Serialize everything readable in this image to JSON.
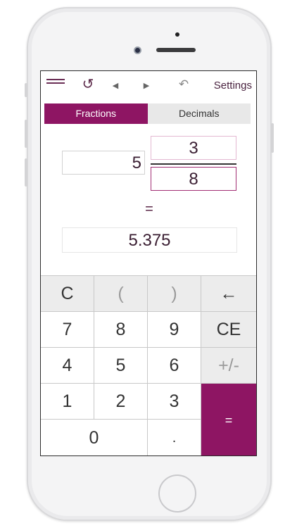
{
  "toolbar": {
    "menu_icon": "hamburger-menu-icon",
    "refresh_glyph": "↺",
    "prev_glyph": "◀",
    "next_glyph": "▶",
    "undo_glyph": "↶",
    "settings_label": "Settings"
  },
  "tabs": [
    {
      "label": "Fractions",
      "active": true
    },
    {
      "label": "Decimals",
      "active": false
    }
  ],
  "fraction": {
    "whole": "5",
    "numerator": "3",
    "denominator": "8"
  },
  "equals_label": "=",
  "result": "5.375",
  "keypad": {
    "clear": "C",
    "open_paren": "(",
    "close_paren": ")",
    "backspace": "←",
    "seven": "7",
    "eight": "8",
    "nine": "9",
    "clear_entry": "CE",
    "four": "4",
    "five": "5",
    "six": "6",
    "sign": "+/-",
    "one": "1",
    "two": "2",
    "three": "3",
    "equals": "=",
    "zero": "0",
    "decimal": "."
  },
  "colors": {
    "accent": "#8e1563",
    "text_dark": "#3a1e32"
  }
}
